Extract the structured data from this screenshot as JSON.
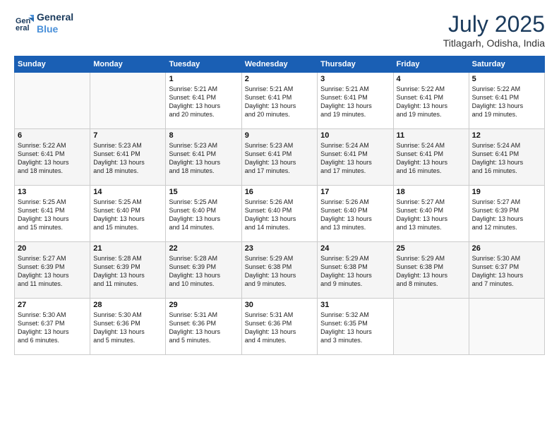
{
  "header": {
    "logo_line1": "General",
    "logo_line2": "Blue",
    "month_year": "July 2025",
    "location": "Titlagarh, Odisha, India"
  },
  "weekdays": [
    "Sunday",
    "Monday",
    "Tuesday",
    "Wednesday",
    "Thursday",
    "Friday",
    "Saturday"
  ],
  "weeks": [
    [
      {
        "day": "",
        "content": ""
      },
      {
        "day": "",
        "content": ""
      },
      {
        "day": "1",
        "content": "Sunrise: 5:21 AM\nSunset: 6:41 PM\nDaylight: 13 hours\nand 20 minutes."
      },
      {
        "day": "2",
        "content": "Sunrise: 5:21 AM\nSunset: 6:41 PM\nDaylight: 13 hours\nand 20 minutes."
      },
      {
        "day": "3",
        "content": "Sunrise: 5:21 AM\nSunset: 6:41 PM\nDaylight: 13 hours\nand 19 minutes."
      },
      {
        "day": "4",
        "content": "Sunrise: 5:22 AM\nSunset: 6:41 PM\nDaylight: 13 hours\nand 19 minutes."
      },
      {
        "day": "5",
        "content": "Sunrise: 5:22 AM\nSunset: 6:41 PM\nDaylight: 13 hours\nand 19 minutes."
      }
    ],
    [
      {
        "day": "6",
        "content": "Sunrise: 5:22 AM\nSunset: 6:41 PM\nDaylight: 13 hours\nand 18 minutes."
      },
      {
        "day": "7",
        "content": "Sunrise: 5:23 AM\nSunset: 6:41 PM\nDaylight: 13 hours\nand 18 minutes."
      },
      {
        "day": "8",
        "content": "Sunrise: 5:23 AM\nSunset: 6:41 PM\nDaylight: 13 hours\nand 18 minutes."
      },
      {
        "day": "9",
        "content": "Sunrise: 5:23 AM\nSunset: 6:41 PM\nDaylight: 13 hours\nand 17 minutes."
      },
      {
        "day": "10",
        "content": "Sunrise: 5:24 AM\nSunset: 6:41 PM\nDaylight: 13 hours\nand 17 minutes."
      },
      {
        "day": "11",
        "content": "Sunrise: 5:24 AM\nSunset: 6:41 PM\nDaylight: 13 hours\nand 16 minutes."
      },
      {
        "day": "12",
        "content": "Sunrise: 5:24 AM\nSunset: 6:41 PM\nDaylight: 13 hours\nand 16 minutes."
      }
    ],
    [
      {
        "day": "13",
        "content": "Sunrise: 5:25 AM\nSunset: 6:41 PM\nDaylight: 13 hours\nand 15 minutes."
      },
      {
        "day": "14",
        "content": "Sunrise: 5:25 AM\nSunset: 6:40 PM\nDaylight: 13 hours\nand 15 minutes."
      },
      {
        "day": "15",
        "content": "Sunrise: 5:25 AM\nSunset: 6:40 PM\nDaylight: 13 hours\nand 14 minutes."
      },
      {
        "day": "16",
        "content": "Sunrise: 5:26 AM\nSunset: 6:40 PM\nDaylight: 13 hours\nand 14 minutes."
      },
      {
        "day": "17",
        "content": "Sunrise: 5:26 AM\nSunset: 6:40 PM\nDaylight: 13 hours\nand 13 minutes."
      },
      {
        "day": "18",
        "content": "Sunrise: 5:27 AM\nSunset: 6:40 PM\nDaylight: 13 hours\nand 13 minutes."
      },
      {
        "day": "19",
        "content": "Sunrise: 5:27 AM\nSunset: 6:39 PM\nDaylight: 13 hours\nand 12 minutes."
      }
    ],
    [
      {
        "day": "20",
        "content": "Sunrise: 5:27 AM\nSunset: 6:39 PM\nDaylight: 13 hours\nand 11 minutes."
      },
      {
        "day": "21",
        "content": "Sunrise: 5:28 AM\nSunset: 6:39 PM\nDaylight: 13 hours\nand 11 minutes."
      },
      {
        "day": "22",
        "content": "Sunrise: 5:28 AM\nSunset: 6:39 PM\nDaylight: 13 hours\nand 10 minutes."
      },
      {
        "day": "23",
        "content": "Sunrise: 5:29 AM\nSunset: 6:38 PM\nDaylight: 13 hours\nand 9 minutes."
      },
      {
        "day": "24",
        "content": "Sunrise: 5:29 AM\nSunset: 6:38 PM\nDaylight: 13 hours\nand 9 minutes."
      },
      {
        "day": "25",
        "content": "Sunrise: 5:29 AM\nSunset: 6:38 PM\nDaylight: 13 hours\nand 8 minutes."
      },
      {
        "day": "26",
        "content": "Sunrise: 5:30 AM\nSunset: 6:37 PM\nDaylight: 13 hours\nand 7 minutes."
      }
    ],
    [
      {
        "day": "27",
        "content": "Sunrise: 5:30 AM\nSunset: 6:37 PM\nDaylight: 13 hours\nand 6 minutes."
      },
      {
        "day": "28",
        "content": "Sunrise: 5:30 AM\nSunset: 6:36 PM\nDaylight: 13 hours\nand 5 minutes."
      },
      {
        "day": "29",
        "content": "Sunrise: 5:31 AM\nSunset: 6:36 PM\nDaylight: 13 hours\nand 5 minutes."
      },
      {
        "day": "30",
        "content": "Sunrise: 5:31 AM\nSunset: 6:36 PM\nDaylight: 13 hours\nand 4 minutes."
      },
      {
        "day": "31",
        "content": "Sunrise: 5:32 AM\nSunset: 6:35 PM\nDaylight: 13 hours\nand 3 minutes."
      },
      {
        "day": "",
        "content": ""
      },
      {
        "day": "",
        "content": ""
      }
    ]
  ]
}
